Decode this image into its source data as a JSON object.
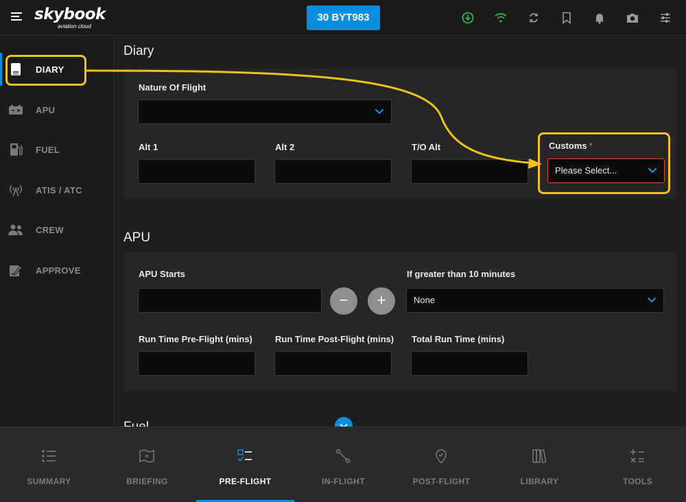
{
  "app": {
    "logo": "skybook",
    "logo_sub": "aviation cloud",
    "flight_button": "30 BYT983"
  },
  "top_icons": [
    "download-icon",
    "wifi-icon",
    "sync-icon",
    "bookmark-icon",
    "bell-icon",
    "camera-icon",
    "settings-sliders-icon"
  ],
  "sidebar": {
    "items": [
      {
        "label": "DIARY",
        "icon": "book-icon",
        "active": true
      },
      {
        "label": "APU",
        "icon": "battery-icon",
        "active": false
      },
      {
        "label": "FUEL",
        "icon": "fuel-pump-icon",
        "active": false
      },
      {
        "label": "ATIS / ATC",
        "icon": "antenna-icon",
        "active": false
      },
      {
        "label": "CREW",
        "icon": "people-icon",
        "active": false
      },
      {
        "label": "APPROVE",
        "icon": "signature-icon",
        "active": false
      }
    ]
  },
  "diary": {
    "title": "Diary",
    "nature_of_flight_label": "Nature Of Flight",
    "nature_of_flight_value": "",
    "alt1_label": "Alt 1",
    "alt2_label": "Alt 2",
    "to_alt_label": "T/O Alt",
    "customs_label": "Customs",
    "customs_required": "*",
    "customs_placeholder": "Please Select..."
  },
  "apu": {
    "title": "APU",
    "apu_starts_label": "APU Starts",
    "minus": "−",
    "plus": "+",
    "greater_label": "If greater than 10 minutes",
    "greater_value": "None",
    "run_pre_label": "Run Time Pre-Flight (mins)",
    "run_post_label": "Run Time Post-Flight (mins)",
    "total_label": "Total Run Time (mins)"
  },
  "next_section_title": "Fuel",
  "bottom_nav": [
    {
      "label": "SUMMARY",
      "icon": "list-icon",
      "active": false
    },
    {
      "label": "BRIEFING",
      "icon": "map-icon",
      "active": false
    },
    {
      "label": "PRE-FLIGHT",
      "icon": "checklist-icon",
      "active": true
    },
    {
      "label": "IN-FLIGHT",
      "icon": "route-icon",
      "active": false
    },
    {
      "label": "POST-FLIGHT",
      "icon": "location-pin-icon",
      "active": false
    },
    {
      "label": "LIBRARY",
      "icon": "books-icon",
      "active": false
    },
    {
      "label": "TOOLS",
      "icon": "calculator-icon",
      "active": false
    }
  ],
  "colors": {
    "accent": "#0a8fe0",
    "highlight": "#f3c11b",
    "error": "#e0473f",
    "sync_green": "#2fb34a"
  }
}
